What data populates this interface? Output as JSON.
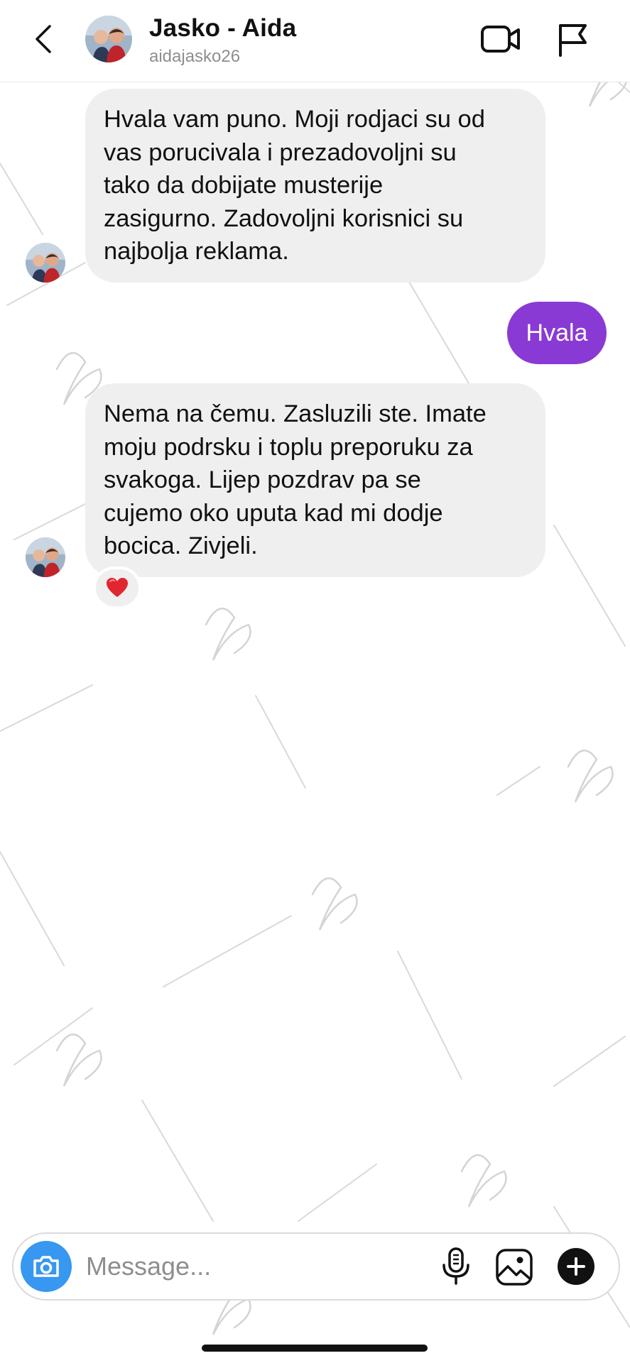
{
  "header": {
    "title": "Jasko - Aida",
    "username": "aidajasko26",
    "icons": [
      "back-icon",
      "video-call-icon",
      "flag-icon"
    ]
  },
  "messages": [
    {
      "direction": "incoming",
      "text": "Hvala vam puno. Moji rodjaci su od\nvas porucivala i prezadovoljni su\ntako da dobijate musterije\nzasigurno. Zadovoljni korisnici su\nnajbolja reklama."
    },
    {
      "direction": "outgoing",
      "text": "Hvala"
    },
    {
      "direction": "incoming",
      "text": "Nema na čemu. Zasluzili ste. Imate\nmoju podrsku i toplu preporuku za\nsvakoga. Lijep pozdrav pa se\ncujemo oko uputa  kad mi dodje\nbocica. Zivjeli.",
      "reaction": "❤️"
    }
  ],
  "composer": {
    "placeholder": "Message...",
    "icons": [
      "camera-icon",
      "microphone-icon",
      "gallery-icon",
      "plus-icon"
    ]
  },
  "colors": {
    "outgoing_bubble": "#8a3ad4",
    "incoming_bubble": "#efefef",
    "camera_button": "#3897f0"
  }
}
